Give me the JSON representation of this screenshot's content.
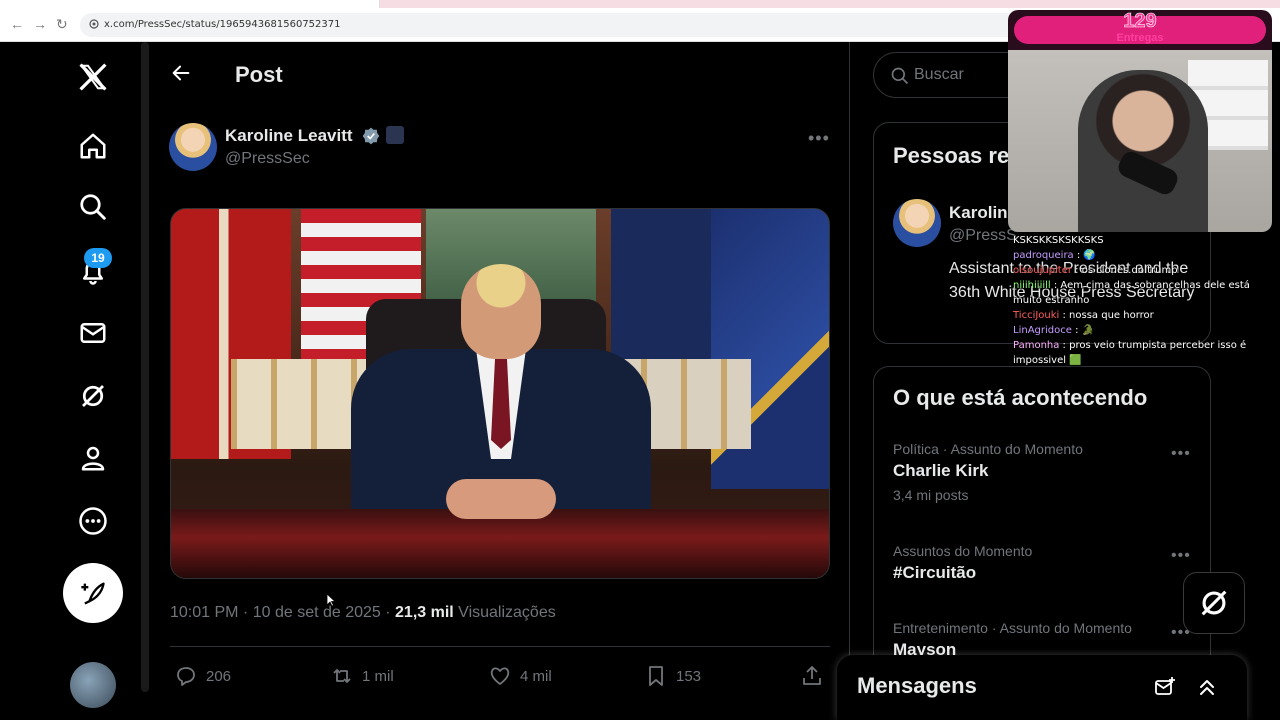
{
  "browser": {
    "url": "x.com/PressSec/status/1965943681560752371"
  },
  "nav": {
    "notifications_badge": "19",
    "items": [
      "x-logo",
      "home-icon",
      "search-icon",
      "bell-icon",
      "mail-icon",
      "grok-icon",
      "profile-icon",
      "more-icon"
    ]
  },
  "header": {
    "title": "Post"
  },
  "post": {
    "author_name": "Karoline Leavitt",
    "author_handle": "@PressSec",
    "timestamp": "10:01 PM · 10 de set de 2025 · ",
    "views_count": "21,3 mil",
    "views_label": " Visualizações",
    "replies": "206",
    "reposts": "1 mil",
    "likes": "4 mil",
    "bookmarks": "153"
  },
  "search": {
    "placeholder": "Buscar"
  },
  "who_to_follow": {
    "title": "Pessoas re",
    "name": "Karolin",
    "handle": "@PressS",
    "bio": "Assistant to the President and the 36th White House Press Secretary"
  },
  "trends": {
    "title": "O que está acontecendo",
    "items": [
      {
        "category": "Política · Assunto do Momento",
        "topic": "Charlie Kirk",
        "count": "3,4 mi posts"
      },
      {
        "category": "Assuntos do Momento",
        "topic": "#Circuitão",
        "count": ""
      },
      {
        "category": "Entretenimento · Assunto do Momento",
        "topic": "Mayson",
        "count": ""
      }
    ]
  },
  "messages": {
    "title": "Mensagens"
  },
  "stream": {
    "counter": "129",
    "counter_label": "Entregas",
    "chat": [
      {
        "user": "",
        "text": "KSKSKKSKSKKSKS"
      },
      {
        "user": "padroqueira",
        "text": " : 🌍"
      },
      {
        "user": "oisoujupiter",
        "text": " : os clones do trump"
      },
      {
        "user": "niiihiiiill",
        "text": " : Aem cima das sobrancelhas dele está muito estranho"
      },
      {
        "user": "TicciJouki",
        "text": " : nossa que horror"
      },
      {
        "user": "LinAgridoce",
        "text": " : 🐊"
      },
      {
        "user": "Pamonha",
        "text": " : pros veio trumpista perceber isso é impossivel 🟩"
      }
    ]
  },
  "colors": {
    "accent": "#1d9bf0",
    "background": "#000000",
    "text_primary": "#e7e9ea",
    "text_secondary": "#71767b",
    "stream_pink": "#e0207a"
  }
}
